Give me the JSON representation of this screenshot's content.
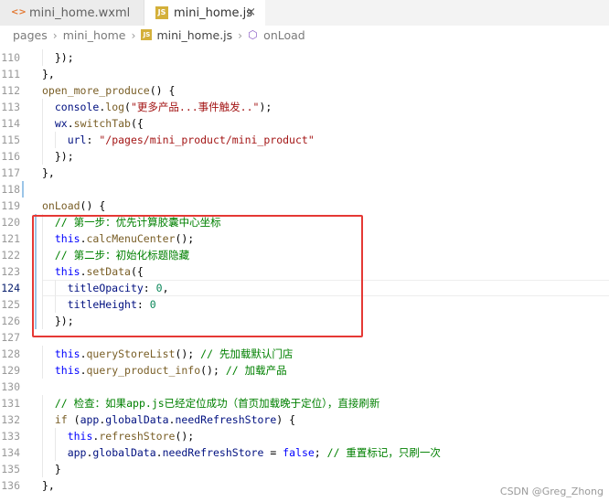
{
  "tabs": [
    {
      "label": "mini_home.wxml",
      "icon": "xml-file-icon"
    },
    {
      "label": "mini_home.js",
      "icon": "js-file-icon",
      "close": "×"
    }
  ],
  "breadcrumb": [
    "pages",
    "mini_home",
    "mini_home.js",
    "onLoad"
  ],
  "code_lines": [
    {
      "n": "110",
      "code": "  });"
    },
    {
      "n": "111",
      "code": "},"
    },
    {
      "n": "112",
      "code": "open_more_produce() {"
    },
    {
      "n": "113",
      "code": "  console.log(\"更多产品...事件触发..\");"
    },
    {
      "n": "114",
      "code": "  wx.switchTab({"
    },
    {
      "n": "115",
      "code": "    url: \"/pages/mini_product/mini_product\""
    },
    {
      "n": "116",
      "code": "  });"
    },
    {
      "n": "117",
      "code": "},"
    },
    {
      "n": "118",
      "code": ""
    },
    {
      "n": "119",
      "code": "onLoad() {"
    },
    {
      "n": "120",
      "code": "  // 第一步：优先计算胶囊中心坐标"
    },
    {
      "n": "121",
      "code": "  this.calcMenuCenter();"
    },
    {
      "n": "122",
      "code": "  // 第二步：初始化标题隐藏"
    },
    {
      "n": "123",
      "code": "  this.setData({"
    },
    {
      "n": "124",
      "code": "    titleOpacity: 0,"
    },
    {
      "n": "125",
      "code": "    titleHeight: 0"
    },
    {
      "n": "126",
      "code": "  });"
    },
    {
      "n": "127",
      "code": ""
    },
    {
      "n": "128",
      "code": "  this.queryStoreList(); // 先加载默认门店"
    },
    {
      "n": "129",
      "code": "  this.query_product_info(); // 加载产品"
    },
    {
      "n": "130",
      "code": ""
    },
    {
      "n": "131",
      "code": "  // 检查：如果app.js已经定位成功（首页加载晚于定位），直接刷新"
    },
    {
      "n": "132",
      "code": "  if (app.globalData.needRefreshStore) {"
    },
    {
      "n": "133",
      "code": "    this.refreshStore();"
    },
    {
      "n": "134",
      "code": "    app.globalData.needRefreshStore = false; // 重置标记，只刷一次"
    },
    {
      "n": "135",
      "code": "  }"
    },
    {
      "n": "136",
      "code": "},"
    }
  ],
  "watermark": "CSDN @Greg_Zhong",
  "colors": {
    "highlight_box": "#e53935",
    "keyword": "#0000ff",
    "comment": "#008000",
    "string": "#a31515"
  }
}
